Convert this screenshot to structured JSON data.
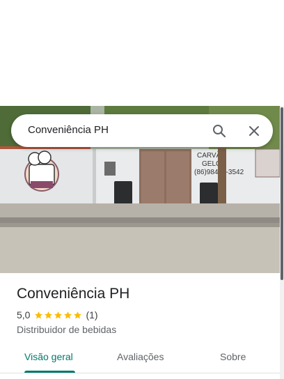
{
  "search": {
    "query": "Conveniência PH"
  },
  "place": {
    "name": "Conveniência PH",
    "rating": "5,0",
    "stars": 5,
    "review_count": "(1)",
    "category": "Distribuidor de bebidas"
  },
  "photo": {
    "wall_sign": "CARVÃO\nGELO\n(86)98447-3542"
  },
  "tabs": [
    {
      "label": "Visão geral",
      "active": true
    },
    {
      "label": "Avaliações",
      "active": false
    },
    {
      "label": "Sobre",
      "active": false
    }
  ],
  "colors": {
    "accent": "#00796b",
    "star": "#fbbc04"
  }
}
